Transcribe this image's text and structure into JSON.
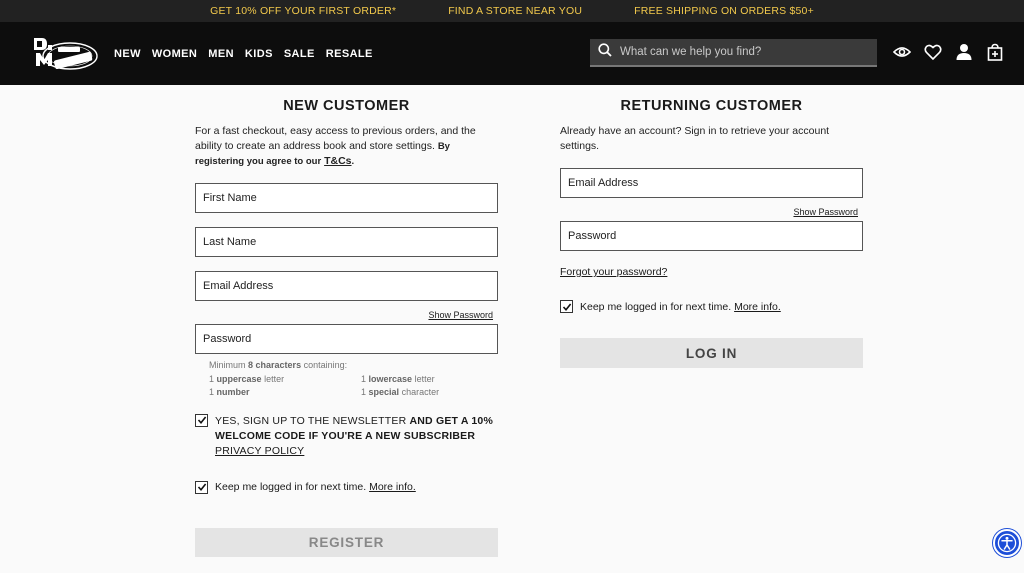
{
  "promo": [
    "GET 10% OFF YOUR FIRST ORDER*",
    "FIND A STORE NEAR YOU",
    "FREE SHIPPING ON ORDERS $50+"
  ],
  "brand": {
    "name": "Dr. Martens",
    "logo_icon": "dr-martens-logo"
  },
  "nav": [
    "NEW",
    "WOMEN",
    "MEN",
    "KIDS",
    "SALE",
    "RESALE"
  ],
  "search": {
    "placeholder": "What can we help you find?"
  },
  "header_icons": [
    "eye-icon",
    "heart-icon",
    "account-icon",
    "bag-icon"
  ],
  "new_customer": {
    "title": "NEW CUSTOMER",
    "desc": "For a fast checkout, easy access to previous orders, and the ability to create an address book and store settings.",
    "desc_bold": "By registering you agree to our",
    "tcs_link": "T&Cs",
    "first_name": "First Name",
    "last_name": "Last Name",
    "email": "Email Address",
    "show_password": "Show Password",
    "password": "Password",
    "rules": {
      "min_prefix": "Minimum",
      "min_bold": "8 characters",
      "min_suffix": "containing:",
      "r1_num": "1",
      "r1_bold": "uppercase",
      "r1_text": "letter",
      "r2_num": "1",
      "r2_bold": "lowercase",
      "r2_text": "letter",
      "r3_num": "1",
      "r3_bold": "number",
      "r4_num": "1",
      "r4_bold": "special",
      "r4_text": "character"
    },
    "newsletter_normal": "YES, SIGN UP TO THE NEWSLETTER",
    "newsletter_bold": "AND GET A 10% WELCOME CODE IF YOU'RE A NEW SUBSCRIBER",
    "privacy_link": "PRIVACY POLICY",
    "newsletter_checked": true,
    "keep_text": "Keep me logged in for next time.",
    "more_info": "More info.",
    "keep_checked": true,
    "register_label": "REGISTER"
  },
  "returning_customer": {
    "title": "RETURNING CUSTOMER",
    "desc": "Already have an account? Sign in to retrieve your account settings.",
    "email": "Email Address",
    "show_password": "Show Password",
    "password": "Password",
    "forgot": "Forgot your password?",
    "keep_text": "Keep me logged in for next time.",
    "more_info": "More info.",
    "keep_checked": true,
    "login_label": "LOG IN"
  },
  "accessibility": {
    "icon": "accessibility-icon",
    "color": "#1d4ed8"
  },
  "colors": {
    "promo_bg": "#222222",
    "promo_text": "#f2c94c",
    "header_bg": "#0d0d0d",
    "button_bg": "#e4e4e4"
  }
}
